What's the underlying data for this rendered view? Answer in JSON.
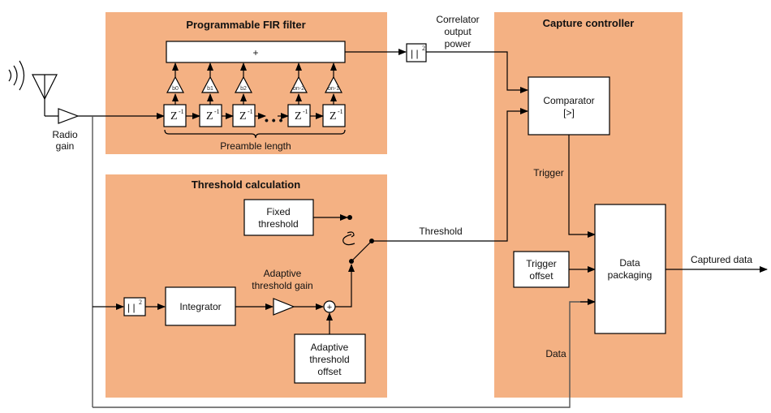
{
  "diagram": {
    "groups": {
      "fir": {
        "title": "Programmable FIR filter",
        "footer": "Preamble length"
      },
      "threshold": {
        "title": "Threshold calculation"
      },
      "capture": {
        "title": "Capture controller"
      }
    },
    "fir": {
      "summer_symbol": "+",
      "delay_label": "Z",
      "delay_exponent": "-1",
      "ellipsis": "• • •",
      "coefficients": [
        "b0",
        "b1",
        "b2",
        "bn-2",
        "bn-1"
      ]
    },
    "blocks": {
      "radio_gain": "Radio\ngain",
      "abs_squared": "|  |",
      "abs_squared_exp": "2",
      "integrator": "Integrator",
      "fixed_threshold": [
        "Fixed",
        "threshold"
      ],
      "adaptive_offset": [
        "Adaptive",
        "threshold",
        "offset"
      ],
      "adder_symbol": "+",
      "comparator": [
        "Comparator",
        "[>]"
      ],
      "trigger_offset": [
        "Trigger",
        "offset"
      ],
      "data_packaging": [
        "Data",
        "packaging"
      ]
    },
    "signals": {
      "correlator_output_power": [
        "Correlator",
        "output",
        "power"
      ],
      "adaptive_threshold_gain": [
        "Adaptive",
        "threshold gain"
      ],
      "threshold": "Threshold",
      "trigger": "Trigger",
      "data": "Data",
      "captured_data": "Captured data",
      "radio_gain_label": [
        "Radio",
        "gain"
      ]
    },
    "colors": {
      "group_fill": "#f4b183",
      "block_fill": "#ffffff",
      "line": "#000000"
    }
  }
}
